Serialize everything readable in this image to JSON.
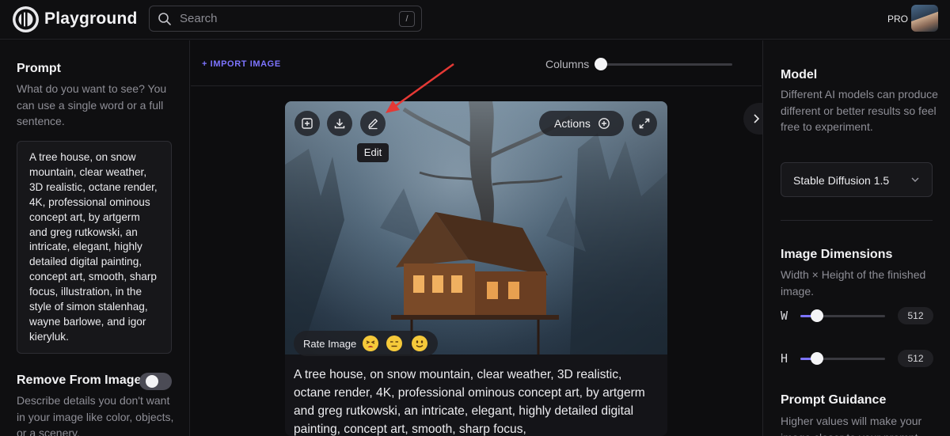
{
  "app": {
    "name": "Playground"
  },
  "search": {
    "placeholder": "Search",
    "shortcut": "/"
  },
  "account": {
    "plan": "PRO"
  },
  "left_panel": {
    "prompt_title": "Prompt",
    "prompt_sub": "What do you want to see? You can use a single word or a full sentence.",
    "prompt_value": "A tree house, on snow mountain, clear weather, 3D realistic, octane render, 4K, professional ominous concept art, by artgerm and greg rutkowski, an intricate, elegant, highly detailed digital painting, concept art, smooth, sharp focus, illustration, in the style of simon stalenhag, wayne barlowe, and igor kieryluk.",
    "remove_title": "Remove From Image",
    "remove_sub": "Describe details you don't want in your image like color, objects, or a scenery.",
    "remove_enabled": false
  },
  "main": {
    "import_label": "+ IMPORT IMAGE",
    "columns_label": "Columns",
    "image_card": {
      "actions_label": "Actions",
      "edit_tooltip": "Edit",
      "rate_label": "Rate Image",
      "rating_icons": [
        "tired-face-icon",
        "neutral-face-icon",
        "slight-smile-icon"
      ],
      "caption": "A tree house, on snow mountain, clear weather, 3D realistic, octane render, 4K, professional ominous concept art, by artgerm and greg rutkowski, an intricate, elegant, highly detailed digital painting, concept art, smooth, sharp focus,"
    }
  },
  "right_panel": {
    "model_title": "Model",
    "model_sub": "Different AI models can produce different or better results so feel free to experiment.",
    "model_value": "Stable Diffusion 1.5",
    "dimensions_title": "Image Dimensions",
    "dimensions_sub": "Width × Height of the finished image.",
    "width_label": "W",
    "width_value": "512",
    "height_label": "H",
    "height_value": "512",
    "guidance_title": "Prompt Guidance",
    "guidance_sub": "Higher values will make your image closer to your prompt."
  },
  "colors": {
    "accent": "#7d74ff",
    "annotation": "#e53935",
    "background": "#0d0d0f"
  }
}
